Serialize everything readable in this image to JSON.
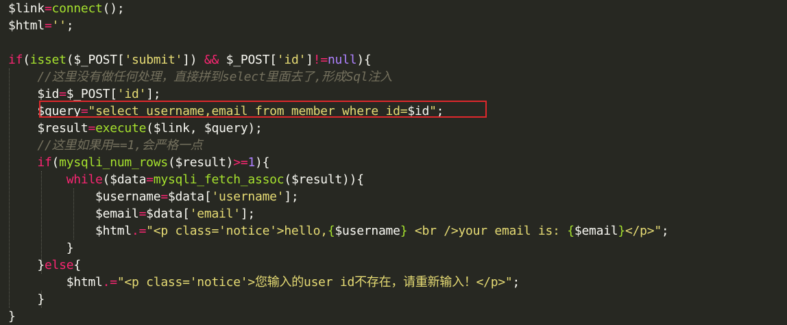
{
  "editor": {
    "lines": [
      [
        {
          "t": "$link",
          "c": "var"
        },
        {
          "t": "=",
          "c": "op"
        },
        {
          "t": "connect",
          "c": "fn"
        },
        {
          "t": "();",
          "c": "pun"
        }
      ],
      [
        {
          "t": "$html",
          "c": "var"
        },
        {
          "t": "=",
          "c": "op"
        },
        {
          "t": "''",
          "c": "str"
        },
        {
          "t": ";",
          "c": "pun"
        }
      ],
      [],
      [
        {
          "t": "if",
          "c": "kw"
        },
        {
          "t": "(",
          "c": "pun"
        },
        {
          "t": "isset",
          "c": "fn"
        },
        {
          "t": "(",
          "c": "pun"
        },
        {
          "t": "$_POST",
          "c": "var"
        },
        {
          "t": "[",
          "c": "pun"
        },
        {
          "t": "'submit'",
          "c": "str"
        },
        {
          "t": "]) ",
          "c": "pun"
        },
        {
          "t": "&&",
          "c": "op"
        },
        {
          "t": " ",
          "c": "pun"
        },
        {
          "t": "$_POST",
          "c": "var"
        },
        {
          "t": "[",
          "c": "pun"
        },
        {
          "t": "'id'",
          "c": "str"
        },
        {
          "t": "]",
          "c": "pun"
        },
        {
          "t": "!=",
          "c": "op"
        },
        {
          "t": "null",
          "c": "num"
        },
        {
          "t": "){",
          "c": "pun"
        }
      ],
      [
        {
          "t": "    ",
          "c": "pun"
        },
        {
          "t": "//这里没有做任何处理，直接拼到select里面去了,形成Sql注入",
          "c": "cmt"
        }
      ],
      [
        {
          "t": "    ",
          "c": "pun"
        },
        {
          "t": "$id",
          "c": "var"
        },
        {
          "t": "=",
          "c": "op"
        },
        {
          "t": "$_POST",
          "c": "var"
        },
        {
          "t": "[",
          "c": "pun"
        },
        {
          "t": "'id'",
          "c": "str"
        },
        {
          "t": "];",
          "c": "pun"
        }
      ],
      [
        {
          "t": "    ",
          "c": "pun"
        },
        {
          "t": "$query",
          "c": "var"
        },
        {
          "t": "=",
          "c": "op"
        },
        {
          "t": "\"select username,email from member where id=",
          "c": "str"
        },
        {
          "t": "$id",
          "c": "var"
        },
        {
          "t": "\"",
          "c": "str"
        },
        {
          "t": ";",
          "c": "pun"
        }
      ],
      [
        {
          "t": "    ",
          "c": "pun"
        },
        {
          "t": "$result",
          "c": "var"
        },
        {
          "t": "=",
          "c": "op"
        },
        {
          "t": "execute",
          "c": "fn"
        },
        {
          "t": "(",
          "c": "pun"
        },
        {
          "t": "$link",
          "c": "var"
        },
        {
          "t": ", ",
          "c": "pun"
        },
        {
          "t": "$query",
          "c": "var"
        },
        {
          "t": ");",
          "c": "pun"
        }
      ],
      [
        {
          "t": "    ",
          "c": "pun"
        },
        {
          "t": "//这里如果用==1,会严格一点",
          "c": "cmt"
        }
      ],
      [
        {
          "t": "    ",
          "c": "pun"
        },
        {
          "t": "if",
          "c": "kw"
        },
        {
          "t": "(",
          "c": "pun"
        },
        {
          "t": "mysqli_num_rows",
          "c": "fn"
        },
        {
          "t": "(",
          "c": "pun"
        },
        {
          "t": "$result",
          "c": "var"
        },
        {
          "t": ")",
          "c": "pun"
        },
        {
          "t": ">=",
          "c": "op"
        },
        {
          "t": "1",
          "c": "num"
        },
        {
          "t": "){",
          "c": "pun"
        }
      ],
      [
        {
          "t": "        ",
          "c": "pun"
        },
        {
          "t": "while",
          "c": "kw"
        },
        {
          "t": "(",
          "c": "pun"
        },
        {
          "t": "$data",
          "c": "var"
        },
        {
          "t": "=",
          "c": "op"
        },
        {
          "t": "mysqli_fetch_assoc",
          "c": "fn"
        },
        {
          "t": "(",
          "c": "pun"
        },
        {
          "t": "$result",
          "c": "var"
        },
        {
          "t": ")){",
          "c": "pun"
        }
      ],
      [
        {
          "t": "            ",
          "c": "pun"
        },
        {
          "t": "$username",
          "c": "var"
        },
        {
          "t": "=",
          "c": "op"
        },
        {
          "t": "$data",
          "c": "var"
        },
        {
          "t": "[",
          "c": "pun"
        },
        {
          "t": "'username'",
          "c": "str"
        },
        {
          "t": "];",
          "c": "pun"
        }
      ],
      [
        {
          "t": "            ",
          "c": "pun"
        },
        {
          "t": "$email",
          "c": "var"
        },
        {
          "t": "=",
          "c": "op"
        },
        {
          "t": "$data",
          "c": "var"
        },
        {
          "t": "[",
          "c": "pun"
        },
        {
          "t": "'email'",
          "c": "str"
        },
        {
          "t": "];",
          "c": "pun"
        }
      ],
      [
        {
          "t": "            ",
          "c": "pun"
        },
        {
          "t": "$html",
          "c": "var"
        },
        {
          "t": ".=",
          "c": "op"
        },
        {
          "t": "\"<p class='notice'>hello,",
          "c": "str"
        },
        {
          "t": "{",
          "c": "brc"
        },
        {
          "t": "$username",
          "c": "var"
        },
        {
          "t": "}",
          "c": "brc"
        },
        {
          "t": " <br />your email is: ",
          "c": "str"
        },
        {
          "t": "{",
          "c": "brc"
        },
        {
          "t": "$email",
          "c": "var"
        },
        {
          "t": "}",
          "c": "brc"
        },
        {
          "t": "</p>\"",
          "c": "str"
        },
        {
          "t": ";",
          "c": "pun"
        }
      ],
      [
        {
          "t": "        ",
          "c": "pun"
        },
        {
          "t": "}",
          "c": "pun"
        }
      ],
      [
        {
          "t": "    ",
          "c": "pun"
        },
        {
          "t": "}",
          "c": "pun"
        },
        {
          "t": "else",
          "c": "kw"
        },
        {
          "t": "{",
          "c": "pun"
        }
      ],
      [
        {
          "t": "        ",
          "c": "pun"
        },
        {
          "t": "$html",
          "c": "var"
        },
        {
          "t": ".=",
          "c": "op"
        },
        {
          "t": "\"<p class='notice'>您输入的user id不存在，请重新输入！</p>\"",
          "c": "str"
        },
        {
          "t": ";",
          "c": "pun"
        }
      ],
      [
        {
          "t": "    ",
          "c": "pun"
        },
        {
          "t": "}",
          "c": "pun"
        }
      ],
      [
        {
          "t": "}",
          "c": "pun"
        }
      ]
    ],
    "highlight_color": "#e0282c",
    "background": "#272822"
  }
}
